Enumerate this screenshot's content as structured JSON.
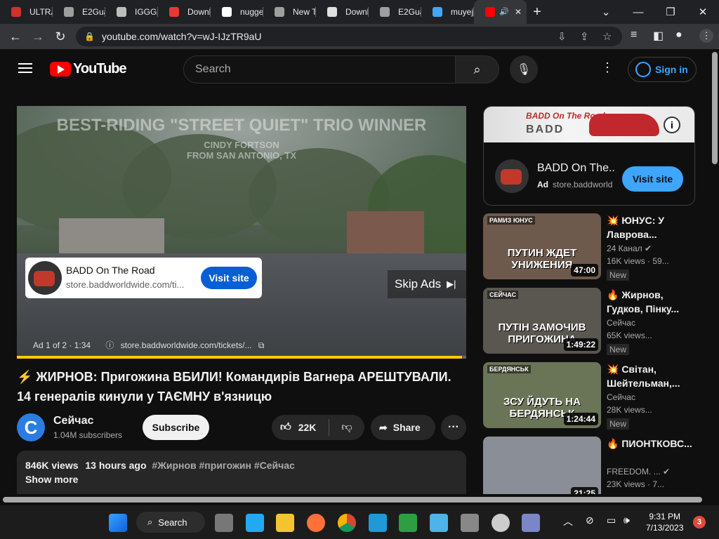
{
  "browser": {
    "tabs": [
      {
        "label": "ULTRA",
        "color": "#d32f2f"
      },
      {
        "label": "E2Gua",
        "color": "#9e9e9e"
      },
      {
        "label": "IGGGA",
        "color": "#bdbdbd"
      },
      {
        "label": "Downl",
        "color": "#e53935"
      },
      {
        "label": "nugge",
        "color": "#ffffff"
      },
      {
        "label": "New T",
        "color": "#9e9e9e"
      },
      {
        "label": "Downl",
        "color": "#e0e0e0"
      },
      {
        "label": "E2Gua",
        "color": "#9e9e9e"
      },
      {
        "label": "muyej",
        "color": "#42a5f5"
      },
      {
        "label": "",
        "color": "#ff0000",
        "active": true
      }
    ],
    "url": "youtube.com/watch?v=wJ-IJzTR9aU"
  },
  "masthead": {
    "logo_text": "YouTube",
    "search_placeholder": "Search",
    "sign_in": "Sign in"
  },
  "player": {
    "overlay_line1": "BEST-RIDING \"STREET QUIET\" TRIO WINNER",
    "overlay_line2": "CINDY FORTSON",
    "overlay_line3": "FROM SAN ANTONIO, TX",
    "ad_title": "BADD On The Road",
    "ad_url": "store.baddworldwide.com/ti...",
    "ad_visit": "Visit site",
    "skip": "Skip Ads",
    "ad_counter": "Ad 1 of 2 · 1:34",
    "ad_link": "store.baddworldwide.com/tickets/...",
    "progress_percent": 99
  },
  "video": {
    "title": "⚡ ЖИРНОВ: Пригожина ВБИЛИ! Командирів Вагнера АРЕШТУВАЛИ. 14 генералів кинули у ТАЄМНУ в'язницю",
    "channel_initial": "C",
    "channel": "Сейчас",
    "subscribers": "1.04M subscribers",
    "subscribe": "Subscribe",
    "likes": "22K",
    "share": "Share",
    "views": "846K views",
    "age": "13 hours ago",
    "tags": "#Жирнов #пригожин #Сейчас",
    "show_more": "Show more"
  },
  "side_ad": {
    "banner_title": "BADD On The Road",
    "banner_logo": "BADD",
    "name": "BADD On The...",
    "ad_label": "Ad",
    "domain": "store.baddworld",
    "visit": "Visit site"
  },
  "recommendations": [
    {
      "title": "💥 ЮНУС: У Лаврова...",
      "channel": "24 Канал",
      "verified": true,
      "views": "16K views · 59...",
      "badge": "New",
      "duration": "47:00",
      "caption": "ПУТИН ЖДЕТ УНИЖЕНИЯ",
      "tag": "РАМИЗ ЮНУС",
      "bg": "#6d5a4c"
    },
    {
      "title": "🔥 Жирнов, Гудков, Пінку...",
      "channel": "Сейчас",
      "verified": false,
      "views": "65K views...",
      "badge": "New",
      "duration": "1:49:22",
      "caption": "ПУТІН ЗАМОЧИВ ПРИГОЖИНА",
      "tag": "СЕЙЧАС",
      "bg": "#5a5650"
    },
    {
      "title": "💥 Світан, Шейтельман,...",
      "channel": "Сейчас",
      "verified": false,
      "views": "28K views...",
      "badge": "New",
      "duration": "1:24:44",
      "caption": "ЗСУ ЙДУТЬ НА БЕРДЯНСЬК",
      "tag": "БЕРДЯНСЬК",
      "bg": "#6a7456"
    },
    {
      "title": "🔥 ПИОНТКОВС...",
      "channel": "FREEDOM. ...",
      "verified": true,
      "views": "23K views · 7...",
      "badge": "",
      "duration": "21:25",
      "caption": "",
      "tag": "",
      "bg": "#8a8e96"
    }
  ],
  "taskbar": {
    "search": "Search",
    "time": "9:31 PM",
    "date": "7/13/2023",
    "notifications": "3"
  }
}
